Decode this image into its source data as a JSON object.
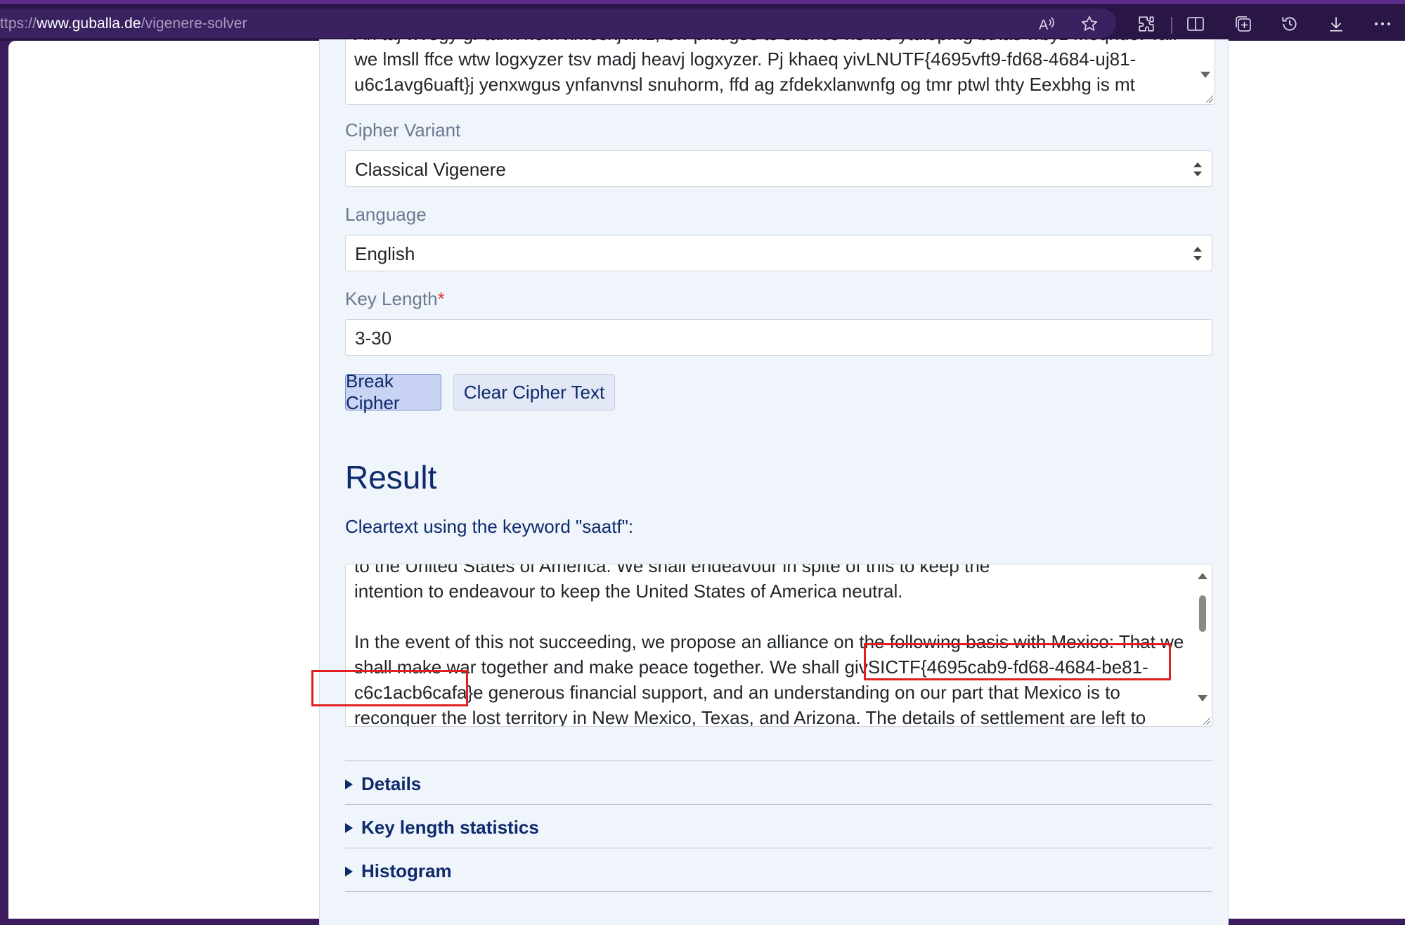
{
  "browser": {
    "url_prefix": "ttps://",
    "url_host": "www.guballa.de",
    "url_path": "/vigenere-solver"
  },
  "cipher": {
    "lines": [
      "An taj wvegy gr tank nom xmcexjvmz, bw pmugse ts slibnce ns ine ytulopmg btxas wbyz Meqhuo: Taif",
      "we lmsll ffce wtw logxyzer tsv madj heavj logxyzer. Pj khaeq yivLNUTF{4695vft9-fd68-4684-uj81-",
      "u6c1avg6uaft}j yenxwgus ynfanvnsl snuhorm, ffd ag zfdekxlanwnfg og tmr ptwl thty Eexbhg is mt"
    ]
  },
  "form": {
    "variant_label": "Cipher Variant",
    "variant_value": "Classical Vigenere",
    "language_label": "Language",
    "language_value": "English",
    "keylength_label": "Key Length",
    "keylength_required": "*",
    "keylength_value": "3-30",
    "break_button": "Break Cipher",
    "clear_button": "Clear Cipher Text"
  },
  "result": {
    "heading": "Result",
    "subtitle": "Cleartext using the keyword \"saatf\":",
    "lines": [
      "to the United States of America. We shall endeavour in spite of this to keep the",
      "intention to endeavour to keep the United States of America neutral.",
      "",
      "In the event of this not succeeding, we propose an alliance on the following basis with Mexico: That we",
      "shall make war together and make peace together. We shall givSICTF{4695cab9-fd68-4684-be81-",
      "c6c1acb6cafa}e generous financial support, and an understanding on our part that Mexico is to",
      "reconquer the lost territory in New Mexico, Texas, and Arizona. The details of settlement are left to"
    ]
  },
  "sections": {
    "details": "Details",
    "keylength_stats": "Key length statistics",
    "histogram": "Histogram"
  }
}
